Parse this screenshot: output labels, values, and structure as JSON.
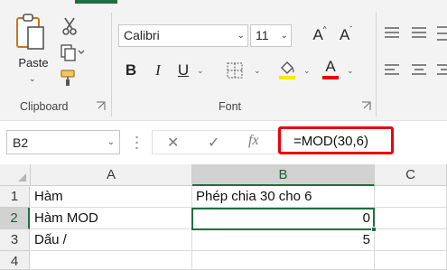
{
  "ribbon": {
    "clipboard": {
      "paste_label": "Paste",
      "group_label": "Clipboard"
    },
    "font": {
      "font_name": "Calibri",
      "font_size": "11",
      "bold_label": "B",
      "italic_label": "I",
      "underline_label": "U",
      "grow_label": "A",
      "shrink_label": "A",
      "font_color_label": "A",
      "group_label": "Font"
    }
  },
  "formula_bar": {
    "name_box": "B2",
    "cancel_glyph": "✕",
    "enter_glyph": "✓",
    "fx_label": "fx",
    "formula": "=MOD(30,6)"
  },
  "sheet": {
    "columns": [
      "A",
      "B",
      "C"
    ],
    "rows": [
      "1",
      "2",
      "3",
      "4"
    ],
    "cells": {
      "A1": "Hàm",
      "B1": "Phép chia 30 cho 6",
      "A2": "Hàm MOD",
      "B2": "0",
      "A3": "Dấu /",
      "B3": "5"
    },
    "selected_cell": "B2"
  },
  "colors": {
    "accent": "#1f6e43",
    "highlight_box": "#e8000d",
    "fill_color_bar": "#ffe600",
    "font_color_bar": "#e8000d"
  }
}
